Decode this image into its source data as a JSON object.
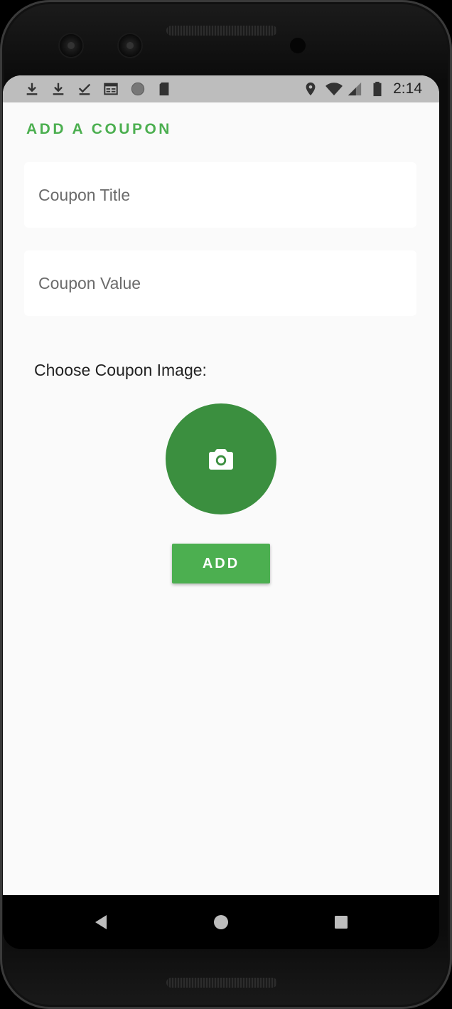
{
  "status_bar": {
    "time": "2:14",
    "left_icons": [
      "download-icon",
      "download-icon",
      "check-download-icon",
      "calendar-icon",
      "circle-icon",
      "sd-card-icon"
    ],
    "right_icons": [
      "location-icon",
      "wifi-icon",
      "signal-icon",
      "battery-icon"
    ]
  },
  "page": {
    "title": "ADD A COUPON"
  },
  "form": {
    "title_placeholder": "Coupon Title",
    "title_value": "",
    "value_placeholder": "Coupon Value",
    "value_value": "",
    "image_label": "Choose Coupon Image:",
    "camera_icon": "camera-icon",
    "add_label": "ADD"
  },
  "nav_bar": {
    "icons": [
      "back-icon",
      "home-icon",
      "recents-icon"
    ]
  },
  "colors": {
    "accent": "#4caf50",
    "camera_button": "#3b8f3f",
    "background": "#fafafa",
    "status_bar": "#bdbdbd"
  }
}
